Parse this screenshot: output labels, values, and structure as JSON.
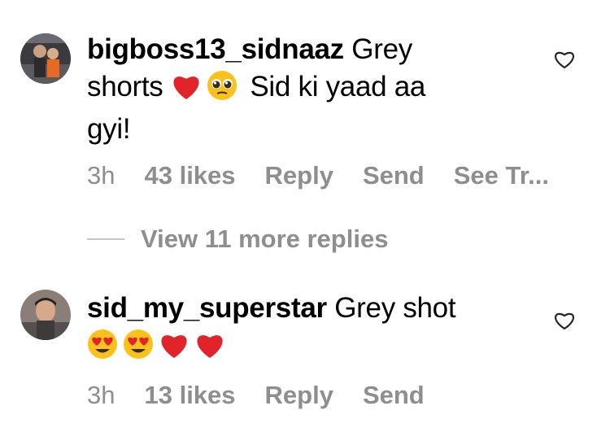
{
  "comments": [
    {
      "username": "bigboss13_sidnaaz",
      "text_line1": "Grey",
      "text_line2": "shorts",
      "emoji_line2": [
        "red-heart",
        "pleading-face"
      ],
      "text_line2b": "Sid ki yaad aa",
      "text_line3": "gyi!",
      "time": "3h",
      "likes": "43 likes",
      "reply": "Reply",
      "send": "Send",
      "see_translation": "See Tr..."
    },
    {
      "username": "sid_my_superstar",
      "text_line1": "Grey shot",
      "emoji_line2": [
        "heart-eyes-face",
        "heart-eyes-face",
        "red-heart",
        "red-heart"
      ],
      "time": "3h",
      "likes": "13 likes",
      "reply": "Reply",
      "send": "Send"
    }
  ],
  "view_more_replies": "View 11 more replies",
  "colors": {
    "meta_text": "#8e8e8e",
    "heart_red": "#e0242a"
  }
}
